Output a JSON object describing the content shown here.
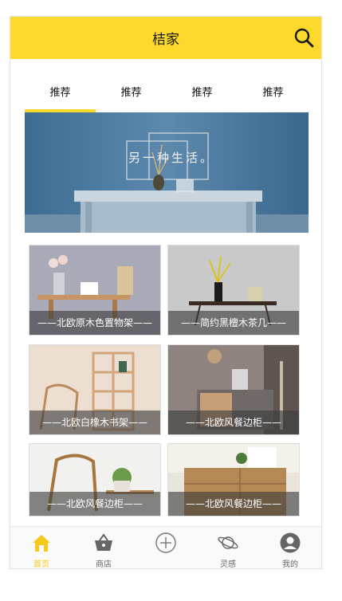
{
  "header": {
    "title": "桔家",
    "search_icon": "search-icon"
  },
  "tabs": [
    {
      "label": "推荐",
      "active": true
    },
    {
      "label": "推荐",
      "active": false
    },
    {
      "label": "推荐",
      "active": false
    },
    {
      "label": "推荐",
      "active": false
    }
  ],
  "banner": {
    "text": "另一种生活。"
  },
  "products": [
    {
      "caption": "——北欧原木色置物架——"
    },
    {
      "caption": "——简约黑檀木茶几——"
    },
    {
      "caption": "——北欧白橡木书架——"
    },
    {
      "caption": "——北欧风餐边柜——"
    },
    {
      "caption": "——北欧风餐边柜——"
    },
    {
      "caption": "——北欧风餐边柜——"
    }
  ],
  "bottom_nav": [
    {
      "label": "首页",
      "icon": "home-icon",
      "active": true
    },
    {
      "label": "商店",
      "icon": "basket-icon",
      "active": false
    },
    {
      "label": "",
      "icon": "add-circle-icon",
      "active": false
    },
    {
      "label": "灵感",
      "icon": "planet-icon",
      "active": false
    },
    {
      "label": "我的",
      "icon": "user-icon",
      "active": false
    }
  ],
  "colors": {
    "accent": "#fcd92c",
    "active_nav": "#f7c81c"
  }
}
